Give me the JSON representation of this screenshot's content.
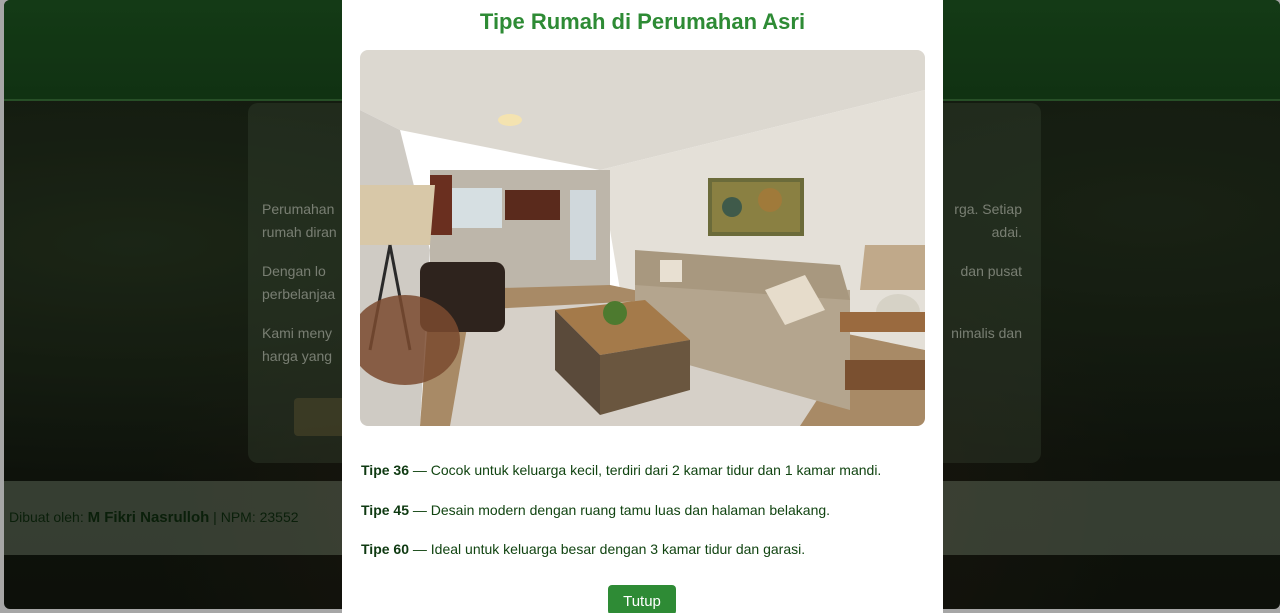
{
  "background": {
    "paragraph_1_left": "Perumahan",
    "paragraph_1_left_2": "rumah diran",
    "paragraph_1_right": "rga. Setiap",
    "paragraph_1_right_2": "adai.",
    "paragraph_2_left": "Dengan lo",
    "paragraph_2_left_2": "perbelanjaa",
    "paragraph_2_right": "dan pusat",
    "paragraph_3_left": "Kami meny",
    "paragraph_3_left_2": "harga yang",
    "paragraph_3_right": "nimalis dan",
    "footer_prefix": "Dibuat oleh: ",
    "footer_name": "M Fikri Nasrulloh",
    "footer_suffix": " | NPM: 23552"
  },
  "modal": {
    "title": "Tipe Rumah di Perumahan Asri",
    "types": [
      {
        "name": "Tipe 36",
        "desc": " — Cocok untuk keluarga kecil, terdiri dari 2 kamar tidur dan 1 kamar mandi."
      },
      {
        "name": "Tipe 45",
        "desc": " — Desain modern dengan ruang tamu luas dan halaman belakang."
      },
      {
        "name": "Tipe 60",
        "desc": " — Ideal untuk keluarga besar dengan 3 kamar tidur dan garasi."
      }
    ],
    "close_label": "Tutup"
  },
  "colors": {
    "accent": "#2e8b35",
    "header": "#1f5a22"
  }
}
